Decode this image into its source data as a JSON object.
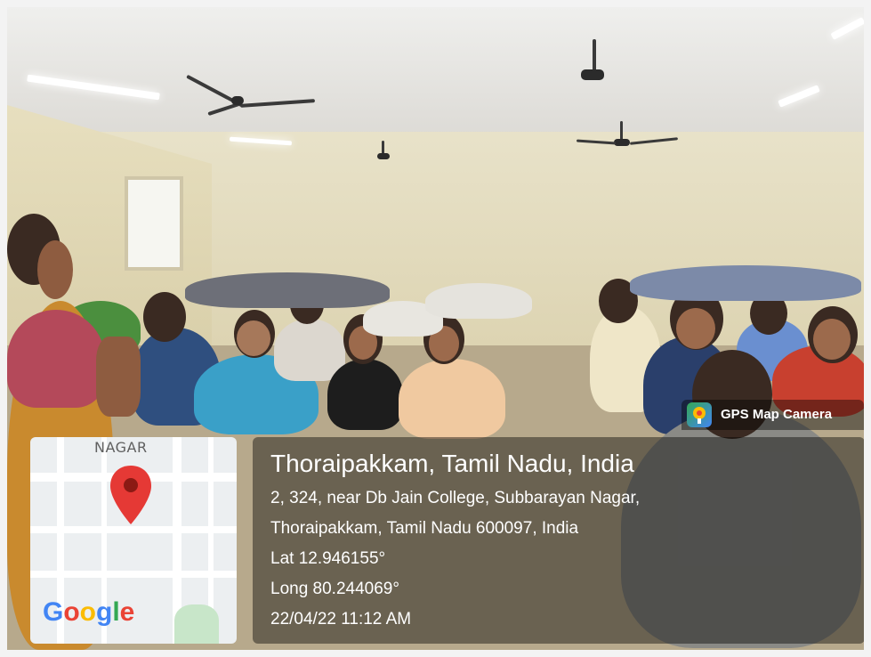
{
  "overlay": {
    "app_badge": "GPS Map Camera",
    "map": {
      "area_label": "NAGAR",
      "brand": [
        "G",
        "o",
        "o",
        "g",
        "l",
        "e"
      ]
    },
    "location": {
      "title": "Thoraipakkam, Tamil Nadu, India",
      "address_line1": "2, 324, near Db Jain College, Subbarayan Nagar,",
      "address_line2": "Thoraipakkam, Tamil Nadu 600097, India",
      "lat": "Lat 12.946155°",
      "long": "Long 80.244069°",
      "datetime": "22/04/22 11:12 AM"
    }
  },
  "colors": {
    "pin": "#e53935",
    "overlay_bg": "rgba(0,0,0,0.42)"
  },
  "icons": {
    "gps": "gps-map-camera-icon",
    "pin": "map-pin-icon"
  }
}
